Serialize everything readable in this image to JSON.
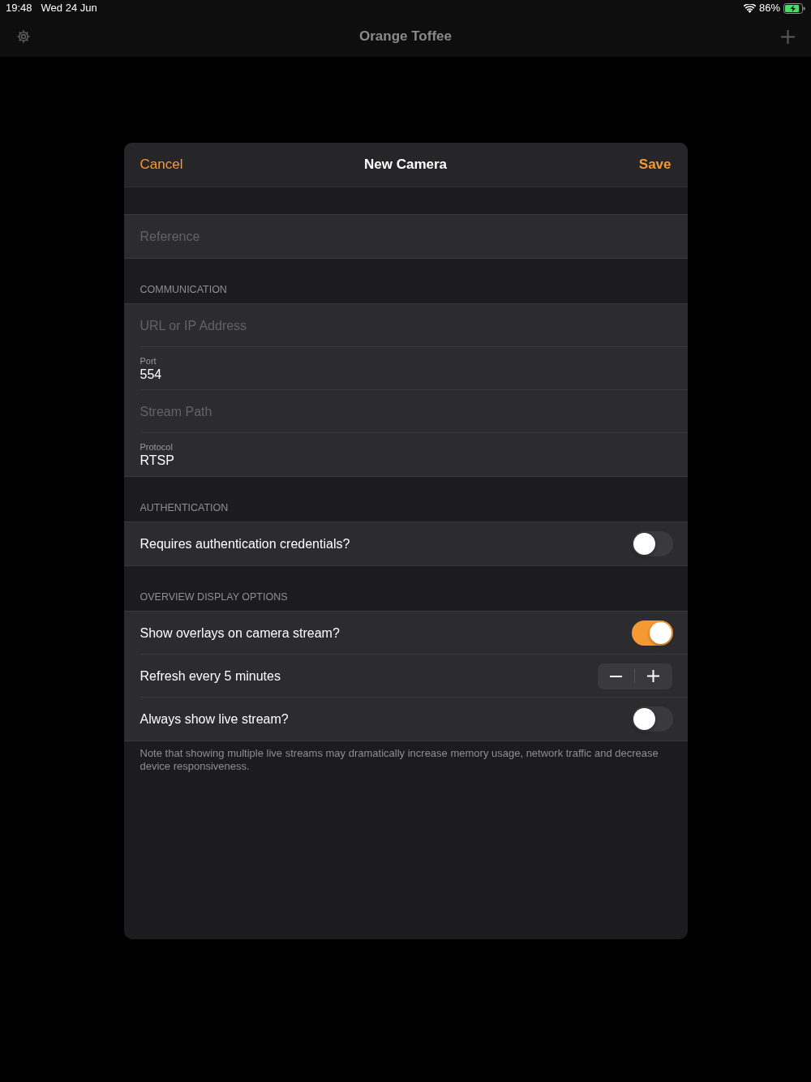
{
  "status_bar": {
    "time": "19:48",
    "date": "Wed 24 Jun",
    "battery": "86%",
    "charging": true
  },
  "nav_bar": {
    "title": "Orange Toffee"
  },
  "dialog": {
    "cancel": "Cancel",
    "title": "New Camera",
    "save": "Save",
    "sections": [
      {
        "rows": [
          {
            "kind": "field",
            "placeholder": "Reference"
          }
        ]
      },
      {
        "header": "COMMUNICATION",
        "rows": [
          {
            "kind": "field",
            "placeholder": "URL or IP Address"
          },
          {
            "kind": "labeled",
            "label": "Port",
            "value": "554"
          },
          {
            "kind": "field",
            "placeholder": "Stream Path"
          },
          {
            "kind": "labeled",
            "label": "Protocol",
            "value": "RTSP"
          }
        ]
      },
      {
        "header": "AUTHENTICATION",
        "rows": [
          {
            "kind": "toggle",
            "label": "Requires authentication credentials?",
            "on": false
          }
        ]
      },
      {
        "header": "OVERVIEW DISPLAY OPTIONS",
        "rows": [
          {
            "kind": "toggle",
            "label": "Show overlays on camera stream?",
            "on": true
          },
          {
            "kind": "stepper",
            "label": "Refresh every 5 minutes"
          },
          {
            "kind": "toggle",
            "label": "Always show live stream?",
            "on": false
          }
        ],
        "footer": "Note that showing multiple live streams may dramatically increase memory usage, network traffic and decrease device responsiveness."
      }
    ]
  }
}
